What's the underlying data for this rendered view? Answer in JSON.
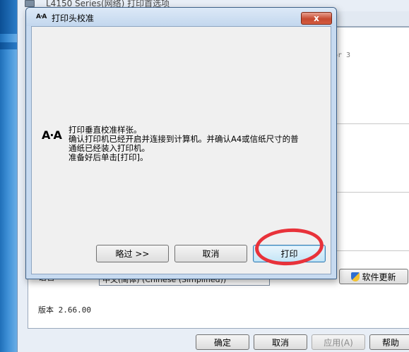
{
  "background_window": {
    "title": "L4150 Series(网络) 打印首选项",
    "fragment_text": "or 3",
    "language_label": "语言",
    "language_select_value": "中文(简体) (Chinese (Simplified))",
    "update_button_label": "软件更新",
    "version_text": "版本 2.66.00",
    "buttons": {
      "ok": "确定",
      "cancel": "取消",
      "apply": "应用(A)",
      "help": "帮助"
    }
  },
  "dialog": {
    "title_icon_text": "A·A",
    "title": "打印头校准",
    "close_glyph": "x",
    "body_icon_text": "A·A",
    "instructions": [
      "打印垂直校准样张。",
      "确认打印机已经开启并连接到计算机。并确认A4或信纸尺寸的普",
      "通纸已经装入打印机。",
      "准备好后单击[打印]。"
    ],
    "buttons": {
      "skip": "略过 >>",
      "cancel": "取消",
      "print": "打印"
    }
  },
  "colors": {
    "highlight": "#e8323a",
    "dialog_frame": "#c7daf0",
    "close_button": "#c64a31"
  }
}
